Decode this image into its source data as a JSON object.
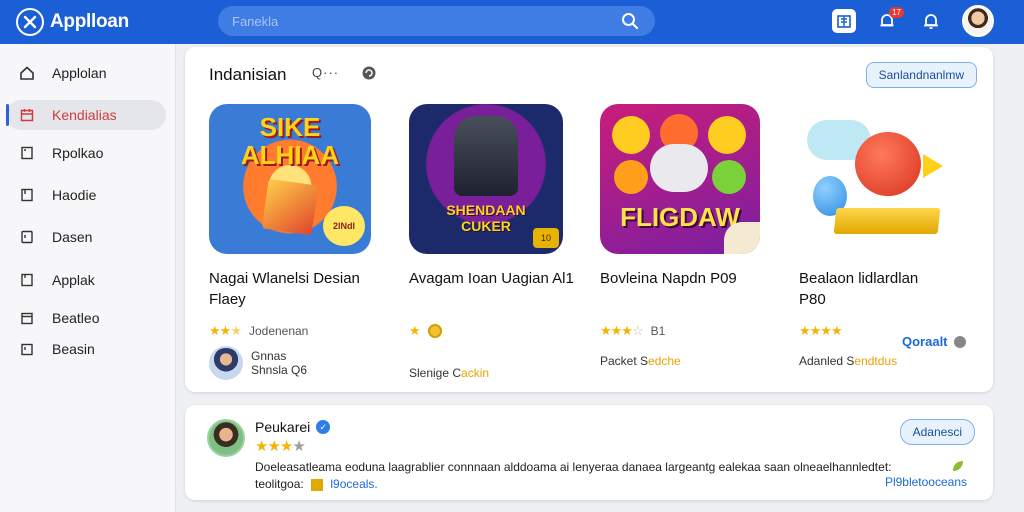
{
  "app": {
    "title": "Applloan"
  },
  "search": {
    "placeholder": "Fanekla"
  },
  "topbar": {
    "notification_badge": "17"
  },
  "sidebar": {
    "items": [
      {
        "label": "Applolan",
        "icon": "home-icon"
      },
      {
        "label": "Kendialias",
        "icon": "calendar-icon"
      },
      {
        "label": "Rpolkao",
        "icon": "page-icon"
      },
      {
        "label": "Haodie",
        "icon": "document-icon"
      },
      {
        "label": "Dasen",
        "icon": "file-icon"
      },
      {
        "label": "Applak",
        "icon": "document-icon"
      },
      {
        "label": "Beatleo",
        "icon": "document-icon"
      },
      {
        "label": "Beasin",
        "icon": "document-icon"
      }
    ]
  },
  "section": {
    "title": "Indanisian",
    "more": "Q···",
    "see_all": "Sanlandnanlmw"
  },
  "apps": [
    {
      "name": "Nagai Wlanelsi Desian Flaey",
      "image_text_1": "SIKE",
      "image_text_2": "ALHIAA",
      "image_badge": "2lNdl",
      "rating_text": "Jodenenan",
      "dev_line_1": "Gnnas",
      "dev_line_2": "Shnsla Q6"
    },
    {
      "name": "Avagam Ioan Uagian Al1",
      "image_text_1": "SHENDAAN",
      "image_text_2": "CUKER",
      "image_badge": "10",
      "meta_prefix": "Slenige C",
      "meta_highlight": "ackin"
    },
    {
      "name": "Bovleina Napdn P09",
      "image_text_1": "FLIGDAW",
      "rating_text": "B1",
      "meta_prefix": "Packet S",
      "meta_highlight": "edche"
    },
    {
      "name": "Bealaon lidlardlan P80",
      "price_link": "Qoraalt",
      "meta_prefix": "Adanled S",
      "meta_highlight": "endtdus"
    }
  ],
  "review": {
    "name": "Peukarei",
    "button": "Adanesci",
    "text": "Doeleasatleama eoduna laagrablier connnaan alddoama ai lenyeraa danaea largeantg ealekaa saan olneaelhannledtet:",
    "text_line2_prefix": "teolitgoa:",
    "text_link": "l9oceals.",
    "more": "Pl9bletooceans"
  },
  "colors": {
    "topbar": "#1a5fd6",
    "accent": "#2a62d8",
    "active_sidebar_text": "#d23b3b",
    "star": "#f5b400"
  }
}
